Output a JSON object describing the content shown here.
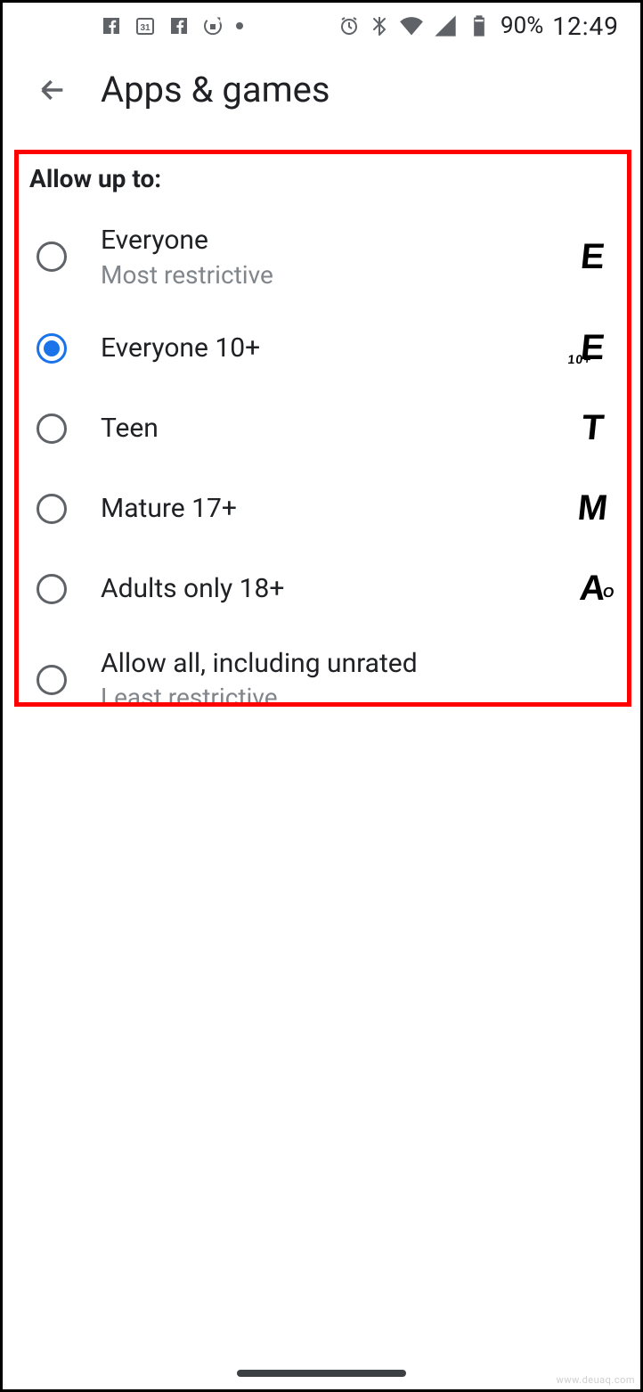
{
  "statusbar": {
    "battery_text": "90%",
    "clock": "12:49"
  },
  "header": {
    "title": "Apps & games"
  },
  "section": {
    "label": "Allow up to:"
  },
  "options": [
    {
      "label": "Everyone",
      "sub": "Most restrictive",
      "badge": "E",
      "selected": false
    },
    {
      "label": "Everyone 10+",
      "sub": "",
      "badge": "E",
      "badge_sub": "10+",
      "selected": true
    },
    {
      "label": "Teen",
      "sub": "",
      "badge": "T",
      "selected": false
    },
    {
      "label": "Mature 17+",
      "sub": "",
      "badge": "M",
      "selected": false
    },
    {
      "label": "Adults only 18+",
      "sub": "",
      "badge": "A",
      "badge_sub": "O",
      "selected": false
    },
    {
      "label": "Allow all, including unrated",
      "sub": "Least restrictive",
      "badge": "",
      "selected": false
    }
  ],
  "watermark": "www.deuaq.com"
}
